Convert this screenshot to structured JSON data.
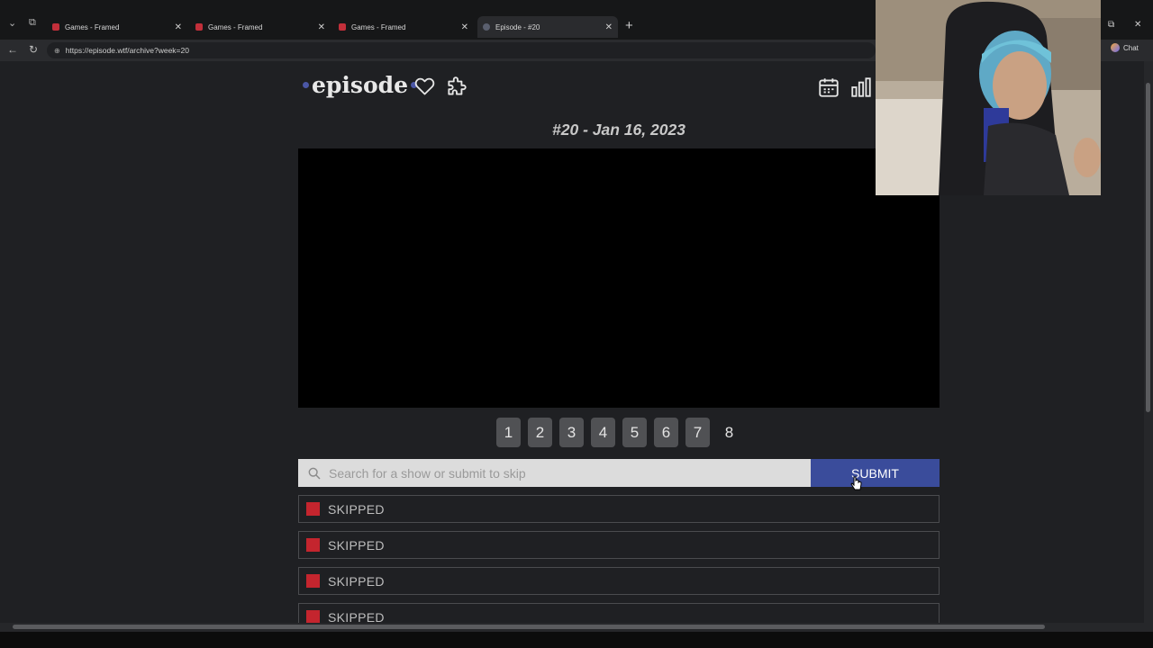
{
  "browser": {
    "tabs": [
      {
        "title": "Games - Framed",
        "favicon": "framed-favicon"
      },
      {
        "title": "Games - Framed",
        "favicon": "framed-favicon"
      },
      {
        "title": "Games - Framed",
        "favicon": "framed-favicon"
      },
      {
        "title": "Episode - #20",
        "favicon": "episode-favicon",
        "active": true
      }
    ],
    "url": "https://episode.wtf/archive?week=20",
    "chat_label": "Chat"
  },
  "site": {
    "logo_text": "episode",
    "accent_color": "#3a4c9b",
    "episode_title": "#20 - Jan 16, 2023",
    "frames": [
      "1",
      "2",
      "3",
      "4",
      "5",
      "6",
      "7",
      "8"
    ],
    "search_placeholder": "Search for a show or submit to skip",
    "submit_label": "SUBMIT",
    "guesses": [
      {
        "text": "SKIPPED",
        "status_color": "#c4252e"
      },
      {
        "text": "SKIPPED",
        "status_color": "#c4252e"
      },
      {
        "text": "SKIPPED",
        "status_color": "#c4252e"
      },
      {
        "text": "SKIPPED",
        "status_color": "#c4252e"
      }
    ]
  }
}
